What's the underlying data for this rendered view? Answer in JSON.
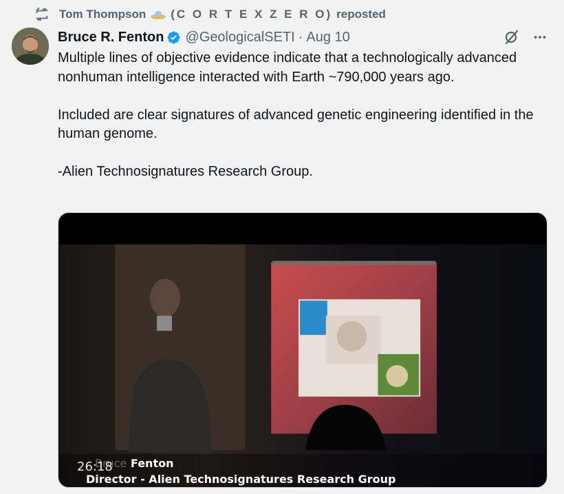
{
  "repost": {
    "icon": "repost-icon",
    "user": "Tom Thompson",
    "emoji": "flying-saucer-icon",
    "cortex": "(C O R T E X Z E R O)",
    "action": "reposted"
  },
  "tweet": {
    "author_name": "Bruce R. Fenton",
    "verified": true,
    "handle": "@GeologicalSETI",
    "separator": "·",
    "date": "Aug 10",
    "text": "Multiple lines of objective evidence indicate that a technologically advanced nonhuman intelligence interacted with Earth ~790,000 years ago.\n\nIncluded are clear signatures of advanced genetic engineering identified in the human genome.\n\n-Alien Technosignatures Research Group."
  },
  "media": {
    "timestamp": "26:18",
    "caption_name_faint": "Bruce",
    "caption_name": "Fenton",
    "caption_title": "Director - Alien Technosignatures Research Group"
  },
  "colors": {
    "accent": "#1d9bf0",
    "secondary_text": "#536471",
    "background": "#f2f2f2"
  }
}
